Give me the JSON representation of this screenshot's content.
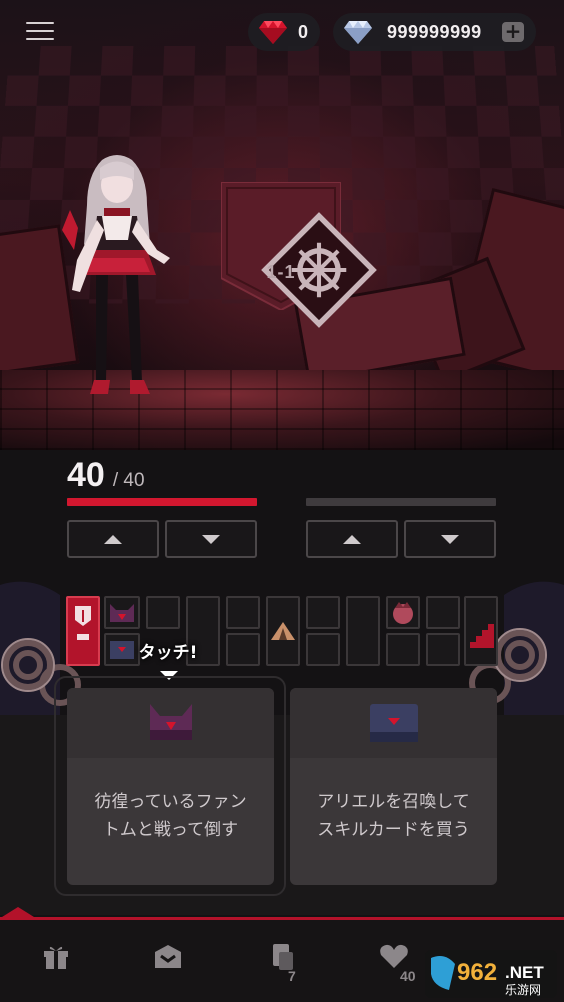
{
  "top_bar": {
    "ruby_count": "0",
    "gem_count": "999999999",
    "add_label": "+"
  },
  "stage": {
    "label": "1-1"
  },
  "player": {
    "hp_current": "40",
    "hp_max": "/ 40",
    "hp_fraction": 1.0
  },
  "enemy": {
    "hp_fraction": 0
  },
  "tooltip": {
    "text": "タッチ!"
  },
  "cards": [
    {
      "line1": "彷徨っているファン",
      "line2": "トムと戦って倒す",
      "icon": "phantom-mask-icon"
    },
    {
      "line1": "アリエルを召喚して",
      "line2": "スキルカードを買う",
      "icon": "treasure-chest-icon"
    }
  ],
  "nav": {
    "deck_badge": "7",
    "heart_badge": "40"
  },
  "watermark": {
    "brand": "962",
    "suffix": ".NET",
    "sub": "乐游网"
  },
  "colors": {
    "accent_red": "#d2172f",
    "bg": "#141214"
  }
}
